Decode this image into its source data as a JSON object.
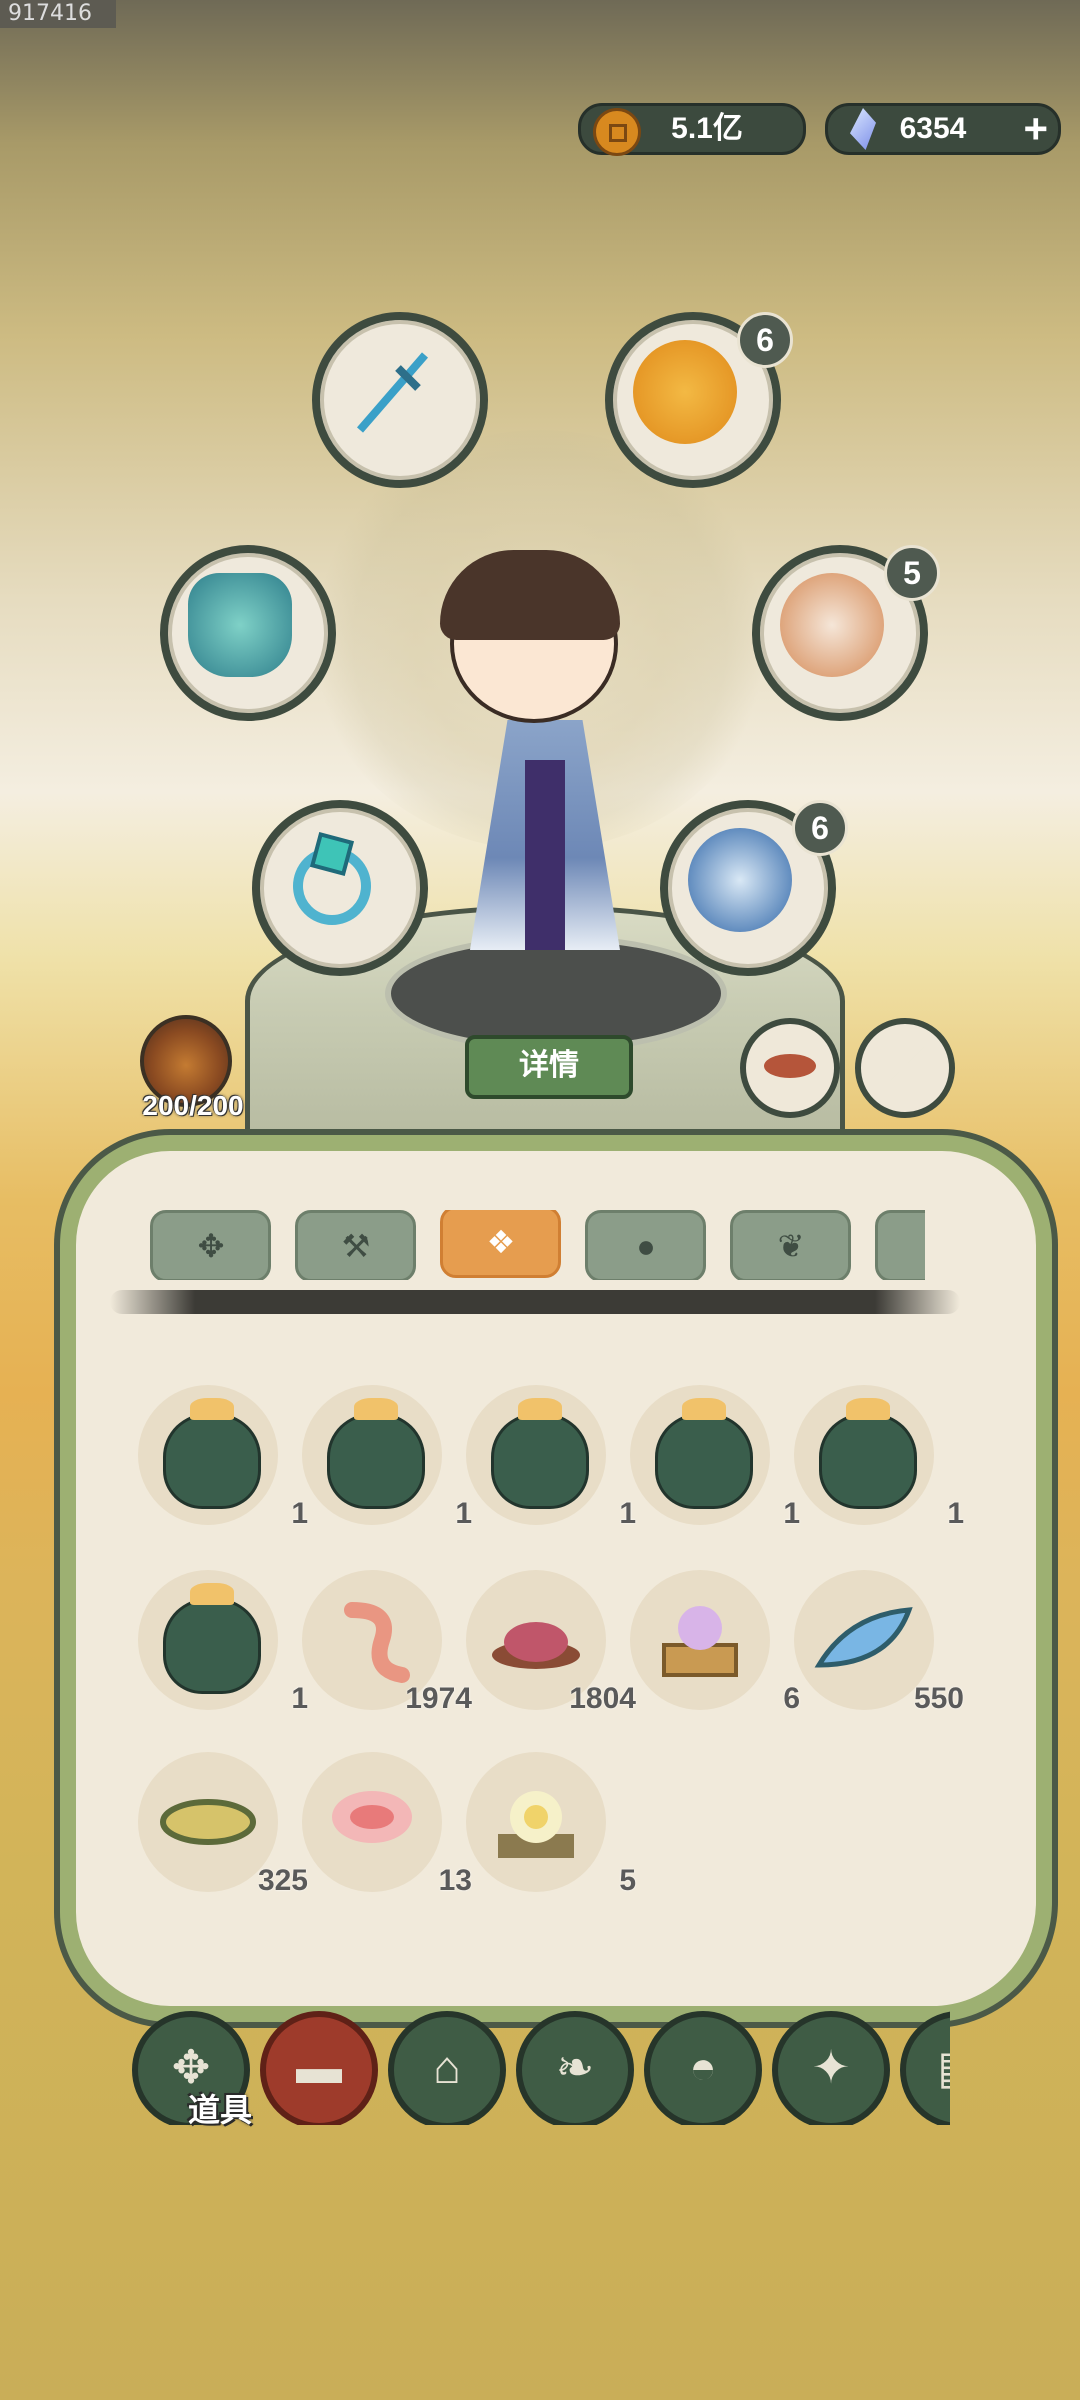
{
  "debug_id": "917416",
  "currency": {
    "coins": "5.1亿",
    "gems": "6354",
    "add_label": "+"
  },
  "equipment_slots": [
    {
      "name": "weapon",
      "icon": "sword-icon"
    },
    {
      "name": "armor",
      "icon": "armor-icon"
    },
    {
      "name": "ring",
      "icon": "ring-icon"
    },
    {
      "name": "companion-1",
      "icon": "companion-portrait-icon",
      "level": "6"
    },
    {
      "name": "companion-2",
      "icon": "companion-portrait-icon",
      "level": "5"
    },
    {
      "name": "companion-3",
      "icon": "companion-portrait-icon",
      "level": "6"
    }
  ],
  "details_label": "详情",
  "stamina": "200/200",
  "tabs": [
    {
      "icon": "grid-icon",
      "active": false
    },
    {
      "icon": "hammer-icon",
      "active": false
    },
    {
      "icon": "ore-icon",
      "active": true
    },
    {
      "icon": "seeds-icon",
      "active": false
    },
    {
      "icon": "sprout-icon",
      "active": false
    },
    {
      "icon": "more-icon",
      "active": false
    }
  ],
  "items": [
    {
      "icon": "pouch-icon",
      "count": "1"
    },
    {
      "icon": "pouch-icon",
      "count": "1"
    },
    {
      "icon": "pouch-icon",
      "count": "1"
    },
    {
      "icon": "pouch-icon",
      "count": "1"
    },
    {
      "icon": "pouch-icon",
      "count": "1"
    },
    {
      "icon": "pouch-icon",
      "count": "1"
    },
    {
      "icon": "worm-icon",
      "count": "1974"
    },
    {
      "icon": "powder-icon",
      "count": "1804"
    },
    {
      "icon": "snake-box-icon",
      "count": "6"
    },
    {
      "icon": "leaf-icon",
      "count": "550"
    },
    {
      "icon": "husk-icon",
      "count": "325"
    },
    {
      "icon": "petal-icon",
      "count": "13"
    },
    {
      "icon": "lotus-icon",
      "count": "5"
    }
  ],
  "bottom_nav": [
    {
      "icon": "grid-icon"
    },
    {
      "icon": "log-icon",
      "label": "道具",
      "active": true
    },
    {
      "icon": "house-icon"
    },
    {
      "icon": "herb-icon"
    },
    {
      "icon": "bowl-icon"
    },
    {
      "icon": "map-icon"
    },
    {
      "icon": "scroll-icon"
    }
  ],
  "colors": {
    "panel_bg": "#f1eadb",
    "panel_border": "#9db072",
    "tab_active": "#e69d4f",
    "nav_active": "#9e3b2b",
    "nav_bg": "#3f5c45"
  }
}
